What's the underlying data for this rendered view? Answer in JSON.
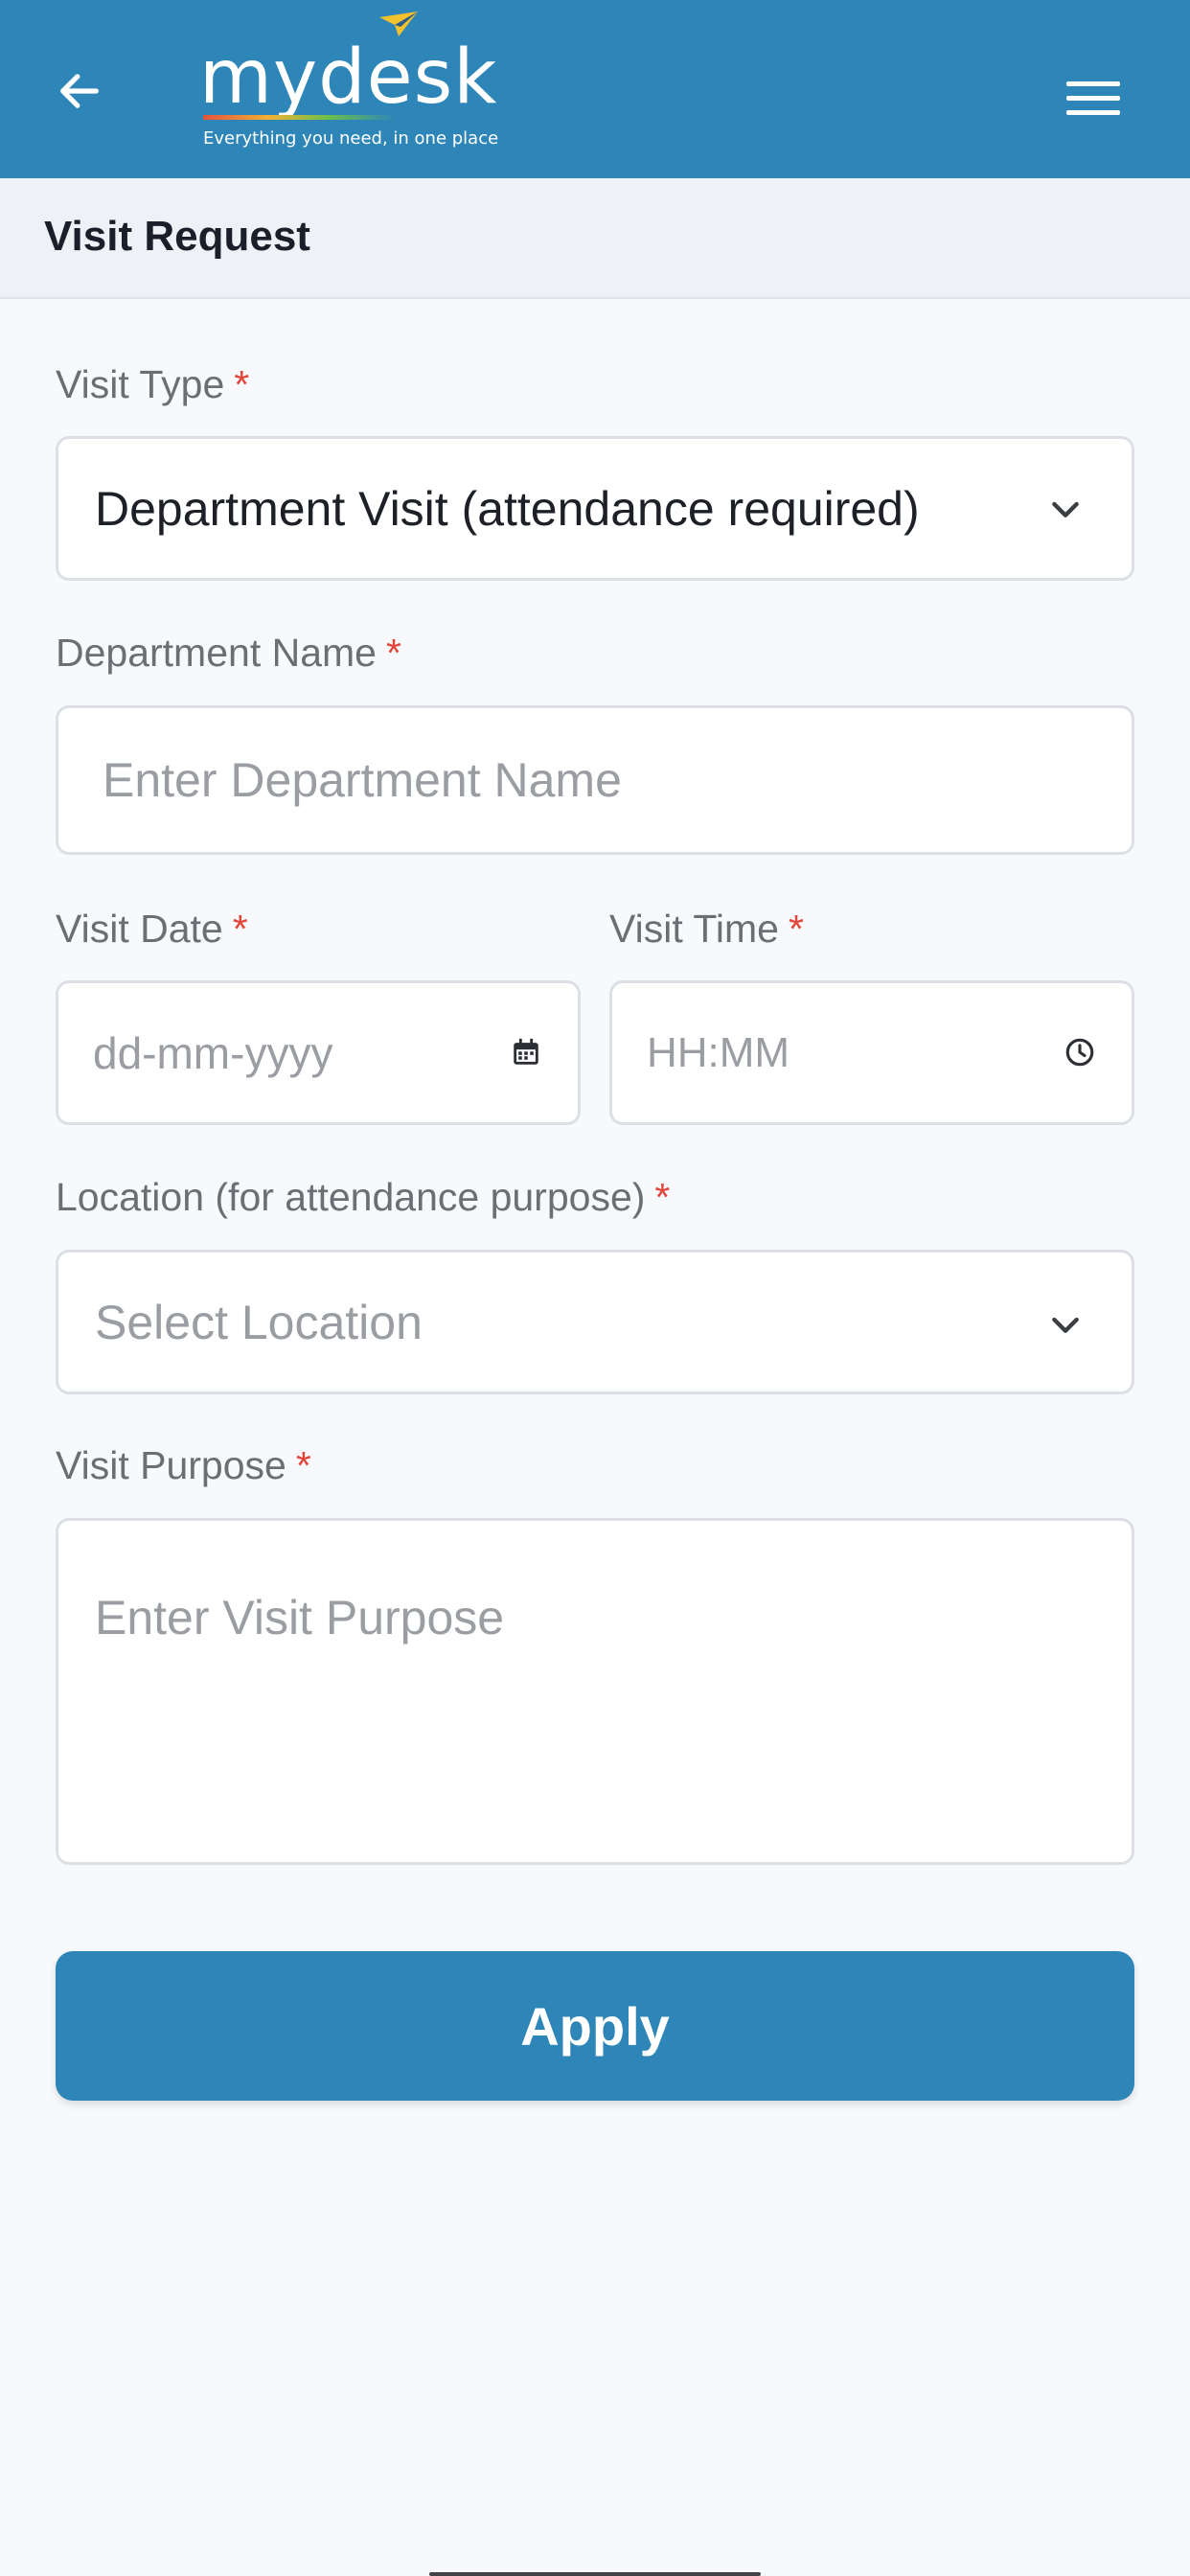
{
  "header": {
    "logo_text": "mydesk",
    "logo_tagline": "Everything you need, in one place",
    "back_icon": "arrow-left-icon",
    "menu_icon": "hamburger-menu-icon",
    "background_color": "#2e86b8"
  },
  "page": {
    "title": "Visit Request"
  },
  "form": {
    "required_marker": "*",
    "visit_type": {
      "label": "Visit Type",
      "value": "Department Visit (attendance required)",
      "icon": "chevron-down-icon"
    },
    "department_name": {
      "label": "Department Name",
      "placeholder": "Enter Department Name"
    },
    "visit_date": {
      "label": "Visit Date",
      "placeholder": "dd-mm-yyyy",
      "icon": "calendar-icon"
    },
    "visit_time": {
      "label": "Visit Time",
      "placeholder": "HH:MM",
      "icon": "clock-icon"
    },
    "location": {
      "label": "Location (for attendance purpose)",
      "placeholder": "Select Location",
      "icon": "chevron-down-icon"
    },
    "visit_purpose": {
      "label": "Visit Purpose",
      "placeholder": "Enter Visit Purpose"
    },
    "apply_label": "Apply"
  },
  "colors": {
    "primary": "#2e86b8",
    "required": "#e2453a",
    "label": "#6b6e73",
    "placeholder": "#9a9da2"
  }
}
